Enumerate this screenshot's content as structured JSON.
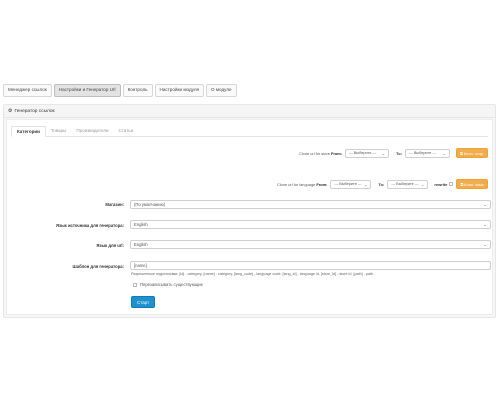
{
  "top_tabs": [
    {
      "label": "Менеджер ссылок",
      "active": false
    },
    {
      "label": "Настройки и Генератор Url",
      "active": true
    },
    {
      "label": "Контроль",
      "active": false
    },
    {
      "label": "Настройки модуля",
      "active": false
    },
    {
      "label": "О модуле",
      "active": false
    }
  ],
  "panel": {
    "icon": "generator-icon",
    "title": "Генератор ссылок"
  },
  "sub_tabs": [
    {
      "label": "Категории",
      "active": true
    },
    {
      "label": "Товары",
      "active": false
    },
    {
      "label": "Производители",
      "active": false
    },
    {
      "label": "Статьи",
      "active": false
    }
  ],
  "clone_store": {
    "label_prefix": "Clone url for store ",
    "label_from": "From:",
    "from_value": "--- Выберите ---",
    "label_to": "To:",
    "to_value": "--- Выберите ---",
    "button_label": "Клон. стор."
  },
  "clone_language": {
    "label_prefix": "Clone url for language ",
    "label_from": "From:",
    "from_value": "--- Выберите ---",
    "label_to": "To:",
    "to_value": "--- Выберите ---",
    "rewrite_label": "rewrite",
    "button_label": "Клон. язык"
  },
  "form": {
    "store_label": "Магазин:",
    "store_value": "(По умолчанию)",
    "source_lang_label": "Язык источника для генератора:",
    "source_lang_value": "English",
    "url_lang_label": "Язык для url:",
    "url_lang_value": "English",
    "template_label": "Шаблон для генератора:",
    "template_value": "[name]",
    "template_help": "Разрешенные подстановки: [id] - category, [name] - category, [lang_code] - language code, [lang_id] - language id, [store_id] - store id, [path] - path",
    "overwrite_label": "Перезаписывать существующие",
    "start_label": "Старт"
  },
  "colors": {
    "accent_orange": "#f0ad4e",
    "primary_blue": "#1e91cf"
  }
}
